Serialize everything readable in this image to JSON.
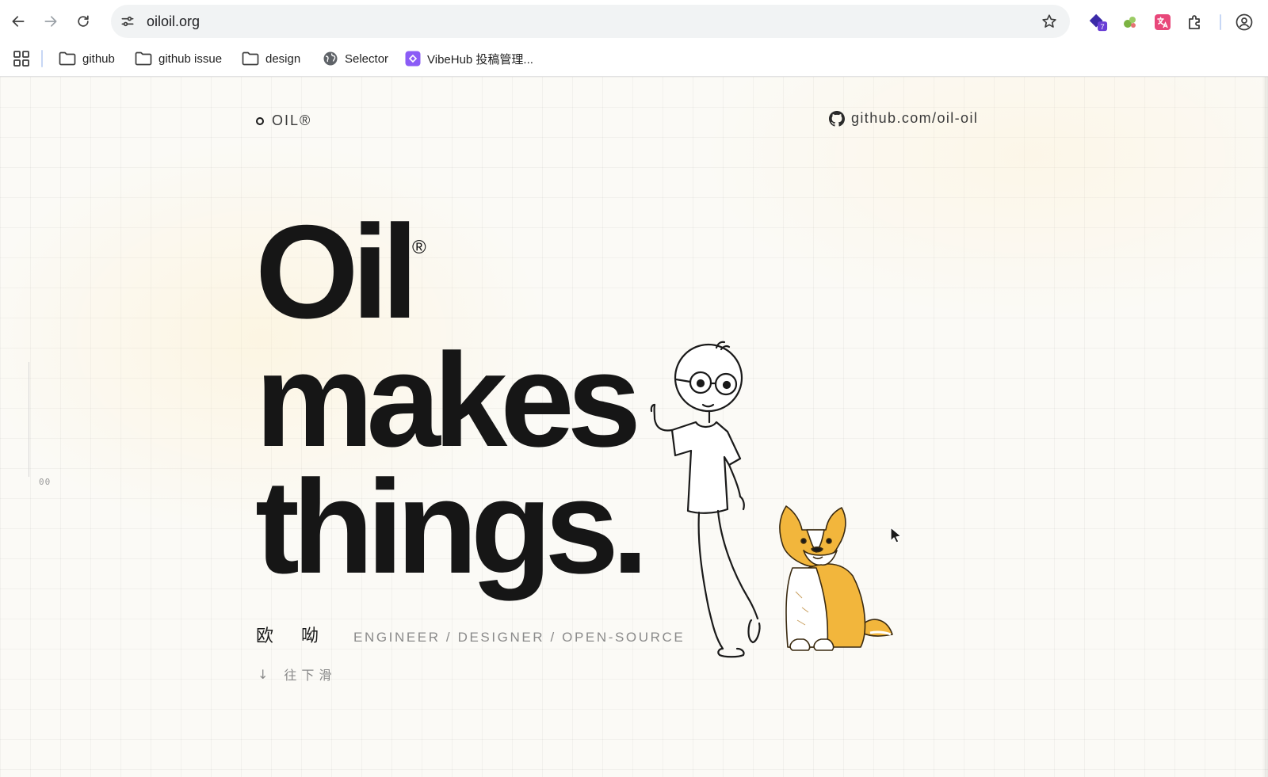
{
  "browser": {
    "url": "oiloil.org",
    "extension_badge": "7",
    "bookmarks": [
      {
        "label": "github",
        "icon": "folder-icon"
      },
      {
        "label": "github issue",
        "icon": "folder-icon"
      },
      {
        "label": "design",
        "icon": "folder-icon"
      },
      {
        "label": "Selector",
        "icon": "globe-icon"
      },
      {
        "label": "VibeHub 投稿管理...",
        "icon": "vibehub-icon"
      }
    ]
  },
  "page": {
    "brand": "OIL®",
    "github_link": "github.com/oil-oil",
    "hero": {
      "line1": "Oil",
      "registered": "®",
      "line2": "makes",
      "line3": "things."
    },
    "name_cn": "欧 呦",
    "roles": "ENGINEER / DESIGNER / OPEN-SOURCE",
    "scroll_arrow": "↓",
    "scroll_hint": "往下滑",
    "side_counter": "00"
  },
  "colors": {
    "page_bg": "#fbfaf6",
    "hero_text": "#161616",
    "muted_text": "#8a8a8a",
    "dog_fur": "#f2b63c"
  }
}
